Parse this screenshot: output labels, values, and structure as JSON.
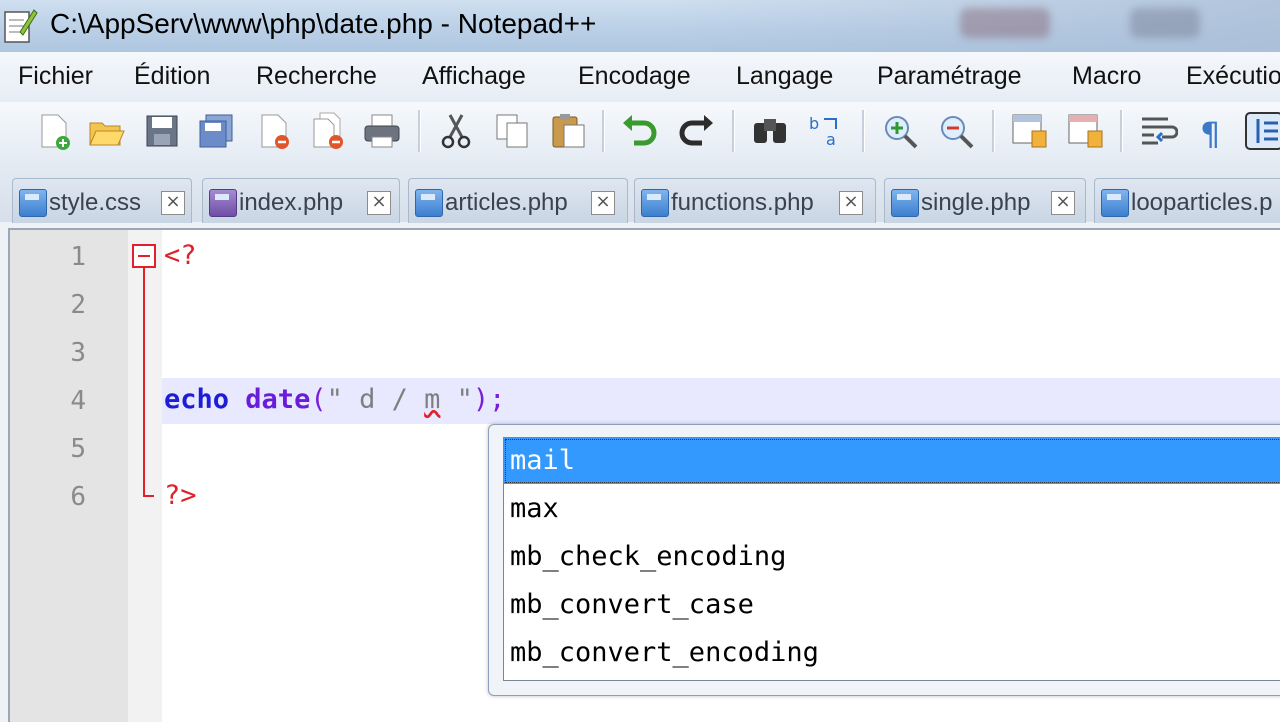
{
  "window": {
    "title": "C:\\AppServ\\www\\php\\date.php - Notepad++"
  },
  "menu": [
    "Fichier",
    "Édition",
    "Recherche",
    "Affichage",
    "Encodage",
    "Langage",
    "Paramétrage",
    "Macro",
    "Exécutio"
  ],
  "toolbar": {
    "icons": [
      "new-file-icon",
      "open-file-icon",
      "save-icon",
      "save-all-icon",
      "close-icon",
      "close-all-icon",
      "print-icon",
      "cut-icon",
      "copy-icon",
      "paste-icon",
      "undo-icon",
      "redo-icon",
      "find-icon",
      "replace-icon",
      "zoom-in-icon",
      "zoom-out-icon",
      "sync-vertical-icon",
      "sync-horizontal-icon",
      "word-wrap-icon",
      "show-all-chars-icon",
      "indent-guide-icon"
    ]
  },
  "tabs": [
    {
      "label": "style.css"
    },
    {
      "label": "index.php"
    },
    {
      "label": "articles.php"
    },
    {
      "label": "functions.php"
    },
    {
      "label": "single.php"
    },
    {
      "label": "looparticles.p"
    }
  ],
  "editor": {
    "line_numbers": [
      "1",
      "2",
      "3",
      "4",
      "5",
      "6"
    ],
    "line1": "<?",
    "line4": {
      "keyword": "echo",
      "func": "date",
      "open": "(",
      "string_open": "\" ",
      "string_d": "d / ",
      "string_m": "m",
      "string_close": " \"",
      "close": ");"
    },
    "line6": "?>"
  },
  "autocomplete": {
    "items": [
      "mail",
      "max",
      "mb_check_encoding",
      "mb_convert_case",
      "mb_convert_encoding"
    ],
    "selected_index": 0
  }
}
